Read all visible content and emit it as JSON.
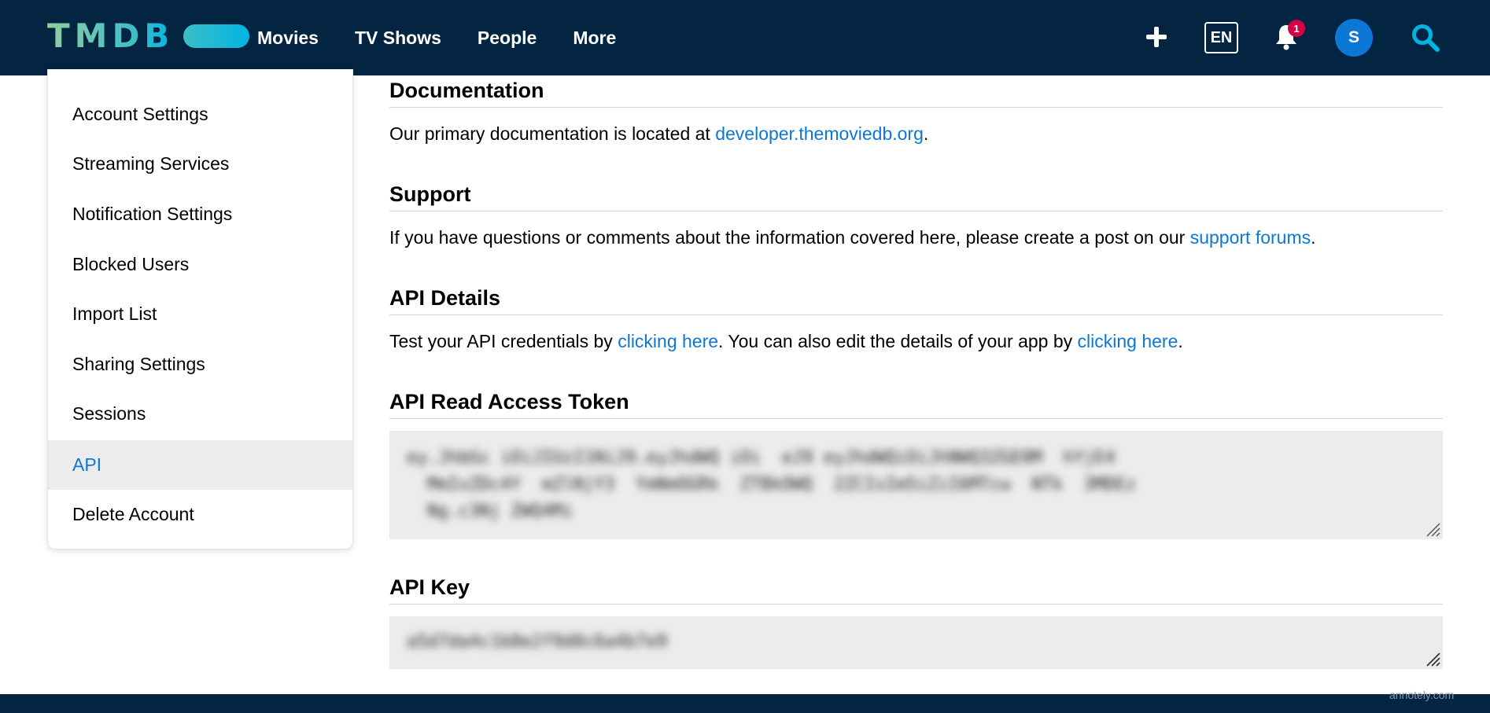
{
  "brand": {
    "logo_text": "TMDB"
  },
  "nav": {
    "items": [
      "Movies",
      "TV Shows",
      "People",
      "More"
    ]
  },
  "header": {
    "language": "EN",
    "notification_count": "1",
    "avatar_initial": "S"
  },
  "sidebar": {
    "items": [
      {
        "label": "Account Settings"
      },
      {
        "label": "Streaming Services"
      },
      {
        "label": "Notification Settings"
      },
      {
        "label": "Blocked Users"
      },
      {
        "label": "Import List"
      },
      {
        "label": "Sharing Settings"
      },
      {
        "label": "Sessions"
      },
      {
        "label": "API",
        "active": true
      },
      {
        "label": "Delete Account"
      }
    ]
  },
  "main": {
    "documentation": {
      "heading": "Documentation",
      "text_before": "Our primary documentation is located at ",
      "link": "developer.themoviedb.org",
      "text_after": "."
    },
    "support": {
      "heading": "Support",
      "text_before": "If you have questions or comments about the information covered here, please create a post on our ",
      "link": "support forums",
      "text_after": "."
    },
    "api_details": {
      "heading": "API Details",
      "text_1": "Test your API credentials by ",
      "link_1": "clicking here",
      "text_2": ". You can also edit the details of your app by ",
      "link_2": "clicking here",
      "text_3": "."
    },
    "read_token": {
      "heading": "API Read Access Token",
      "line_1": "ey.JhbGc iOiJIUzI1NiJ9.eyJhdWQ iOi  eJ9 eyJhdWQiOiJhNWQ3ZGE0M  hYjE4",
      "line_2": "MmIxZDc4Y  mZlNjY3  YmNmOGRk  ZTBkOWQ  2ZCIsIm5iZiI6MTcw  NTk  3MDEz",
      "line_3": "Ng.c3Nj ZWQ4Mi"
    },
    "api_key": {
      "heading": "API Key",
      "value": "a5d7da4c1b8e2f9d0c6a4b7e9"
    }
  },
  "footer": {
    "watermark": "annotely.com"
  },
  "colors": {
    "header_bg": "#032541",
    "link": "#0d77d5",
    "badge": "#d40242",
    "avatar": "#0d77d5",
    "active_bg": "#ececec",
    "logo_green": "#90cea1",
    "logo_blue": "#01b4e4"
  }
}
